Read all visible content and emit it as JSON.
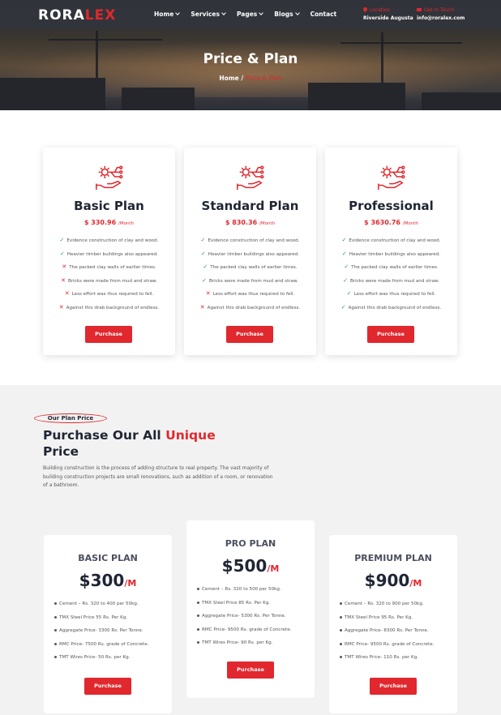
{
  "header": {
    "logo_a": "RORA",
    "logo_b": "LEX",
    "nav": [
      {
        "label": "Home"
      },
      {
        "label": "Services"
      },
      {
        "label": "Pages"
      },
      {
        "label": "Blogs"
      },
      {
        "label": "Contact"
      }
    ],
    "location_label": "Location",
    "location_value": "Riverside Augusta",
    "contact_label": "Get In Touch",
    "contact_value": "info@roralex.com"
  },
  "hero": {
    "title": "Price & Plan",
    "crumb_home": "Home",
    "crumb_sep": "/",
    "crumb_current": "Price & Plan"
  },
  "plans": [
    {
      "name": "Basic Plan",
      "price": "$ 330.96",
      "per": "/Month",
      "button": "Purchase",
      "features": [
        {
          "mark": "✓",
          "ok": true,
          "text": "Evidence construction of clay and wood."
        },
        {
          "mark": "✓",
          "ok": true,
          "text": "Heavier timber buildings also appeared."
        },
        {
          "mark": "✕",
          "ok": false,
          "text": "The packed clay walls of earlier times."
        },
        {
          "mark": "✕",
          "ok": false,
          "text": "Bricks were made from mud and straw."
        },
        {
          "mark": "✕",
          "ok": false,
          "text": "Less effort was thus required to fell."
        },
        {
          "mark": "✕",
          "ok": false,
          "text": "Against this drab background of endless."
        }
      ]
    },
    {
      "name": "Standard Plan",
      "price": "$ 830.36",
      "per": "/Month",
      "button": "Purchase",
      "features": [
        {
          "mark": "✓",
          "ok": true,
          "text": "Evidence construction of clay and wood."
        },
        {
          "mark": "✓",
          "ok": true,
          "text": "Heavier timber buildings also appeared."
        },
        {
          "mark": "✓",
          "ok": true,
          "text": "The packed clay walls of earlier times."
        },
        {
          "mark": "✓",
          "ok": true,
          "text": "Bricks were made from mud and straw."
        },
        {
          "mark": "✕",
          "ok": false,
          "text": "Less effort was thus required to fell."
        },
        {
          "mark": "✕",
          "ok": false,
          "text": "Against this drab background of endless."
        }
      ]
    },
    {
      "name": "Professional",
      "price": "$ 3630.76",
      "per": "/Month",
      "button": "Purchase",
      "features": [
        {
          "mark": "✓",
          "ok": true,
          "text": "Evidence construction of clay and wood."
        },
        {
          "mark": "✓",
          "ok": true,
          "text": "Heavier timber buildings also appeared."
        },
        {
          "mark": "✓",
          "ok": true,
          "text": "The packed clay walls of earlier times."
        },
        {
          "mark": "✓",
          "ok": true,
          "text": "Bricks were made from mud and straw."
        },
        {
          "mark": "✓",
          "ok": true,
          "text": "Less effort was thus required to fell."
        },
        {
          "mark": "✓",
          "ok": true,
          "text": "Against this drab background of endless."
        }
      ]
    }
  ],
  "section2": {
    "tag": "Our Plan Price",
    "heading_a": "Purchase Our All ",
    "heading_b": "Unique",
    "heading_c": "Price",
    "desc": "Building construction is the process of adding structure to real property. The vast majority of building construction projects are small renovations, such as addition of a room, or renovation of a bathroom."
  },
  "price_cards": [
    {
      "name": "BASIC PLAN",
      "price": "$300",
      "unit": "/M",
      "button": "Purchase",
      "features": [
        "Cement – Rs. 320 to 400 per 50kg.",
        "TMX Steel Price 55 Rs. Per Kg.",
        "Aggregate Price- 3300 Rs. Per Tonne.",
        "RMC Price- 7500 Rs. grade of Concrete.",
        "TMT Wires Price- 50 Rs. per Kg."
      ]
    },
    {
      "name": "PRO PLAN",
      "price": "$500",
      "unit": "/M",
      "button": "Purchase",
      "features": [
        "Cement – Rs. 320 to 500 per 50kg.",
        "TMX Steel Price 85 Rs. Per Kg.",
        "Aggregate Price- 5300 Rs. Per Tonne.",
        "RMC Price- 9500 Rs. grade of Concrete.",
        "TMT Wires Price- 90 Rs. per Kg."
      ]
    },
    {
      "name": "PREMIUM PLAN",
      "price": "$900",
      "unit": "/M",
      "button": "Purchase",
      "features": [
        "Cement – Rs. 320 to 900 per 50kg.",
        "TMX Steel Price 95 Rs. Per Kg.",
        "Aggregate Price- 8300 Rs. Per Tonne.",
        "RMC Price- 9500 Rs. grade of Concrete.",
        "TMT Wires Price- 110 Rs. per Kg."
      ]
    }
  ]
}
